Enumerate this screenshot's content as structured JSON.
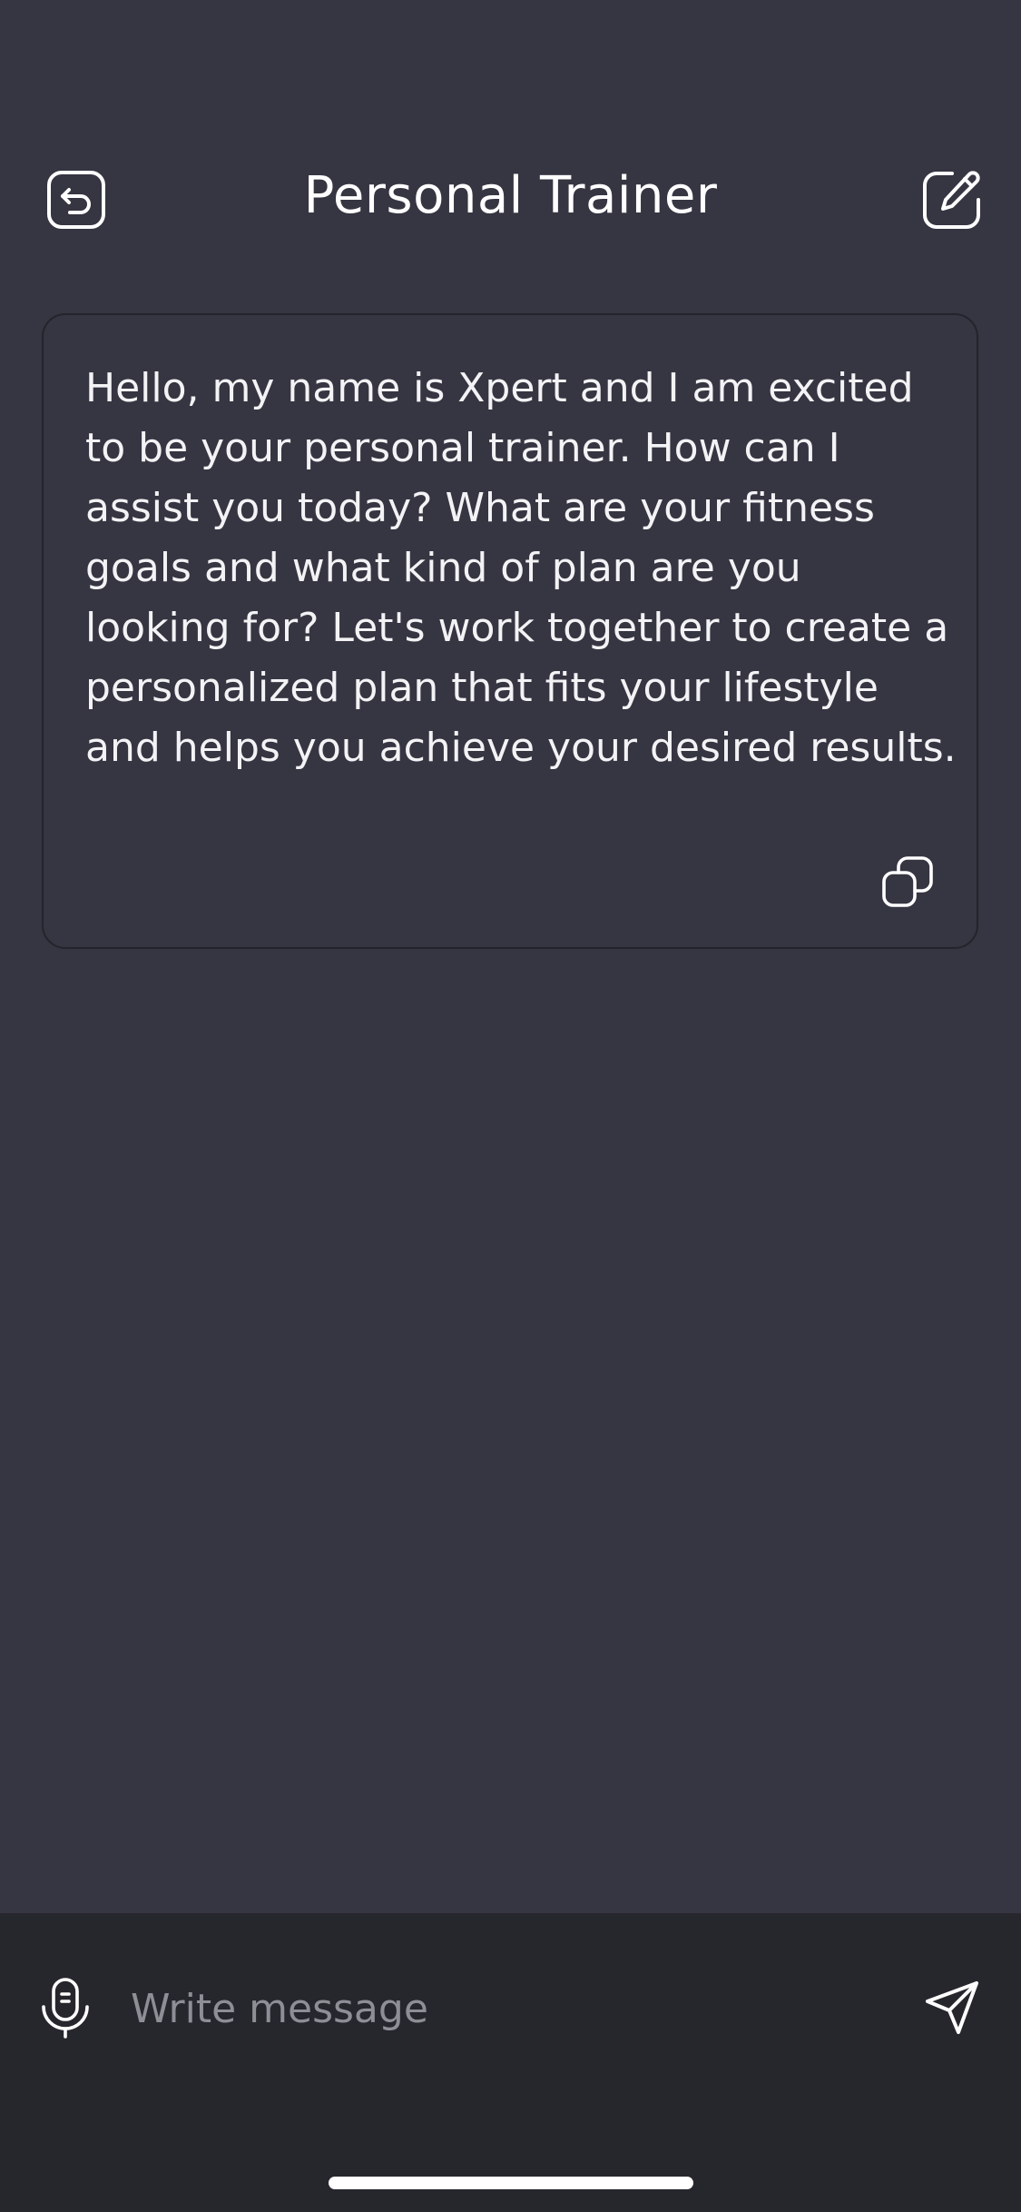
{
  "header": {
    "title": "Personal Trainer",
    "back_icon": "undo-back-icon",
    "edit_icon": "edit-pencil-icon"
  },
  "message": {
    "text": "Hello, my name is Xpert and I am excited to be your personal trainer. How can I assist you today? What are your fitness goals and what kind of plan are you looking for? Let's work together to create a personalized plan that fits your lifestyle and helps you achieve your desired results.",
    "copy_icon": "copy-icon"
  },
  "composer": {
    "placeholder": "Write message",
    "mic_icon": "microphone-icon",
    "send_icon": "send-icon"
  },
  "colors": {
    "background": "#363542",
    "input_bar": "#26262d",
    "card_border": "#24242b",
    "text": "#ffffff",
    "placeholder": "#8e8e96"
  }
}
